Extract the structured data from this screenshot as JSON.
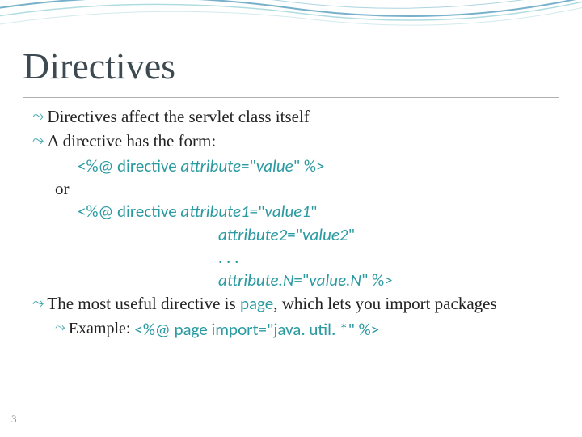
{
  "title": "Directives",
  "bullets": {
    "b1": "Directives affect the servlet class itself",
    "b2": "A directive has the form:",
    "code1_prefix": "<%@ directive ",
    "code1_attr": "attribute",
    "code1_eq": "=\"",
    "code1_val": "value",
    "code1_suffix": "\" %>",
    "or": "or",
    "code2_prefix": "<%@ directive ",
    "code2_attr1": "attribute1",
    "code2_eq": "=\"",
    "code2_val1": "value1",
    "code2_q": "\"",
    "code2_attr2": "attribute2",
    "code2_val2": "value2",
    "code2_dots": ". . .",
    "code2_attrN": "attribute.N",
    "code2_valN": "value.N",
    "code2_end": "\" %>",
    "b3_pre": "The most useful directive is ",
    "b3_code": "page",
    "b3_post": ", which lets you import packages",
    "ex_label": "Example:  ",
    "ex_code": "<%@ page import=\"java. util. *\" %>"
  },
  "pageNumber": "3"
}
